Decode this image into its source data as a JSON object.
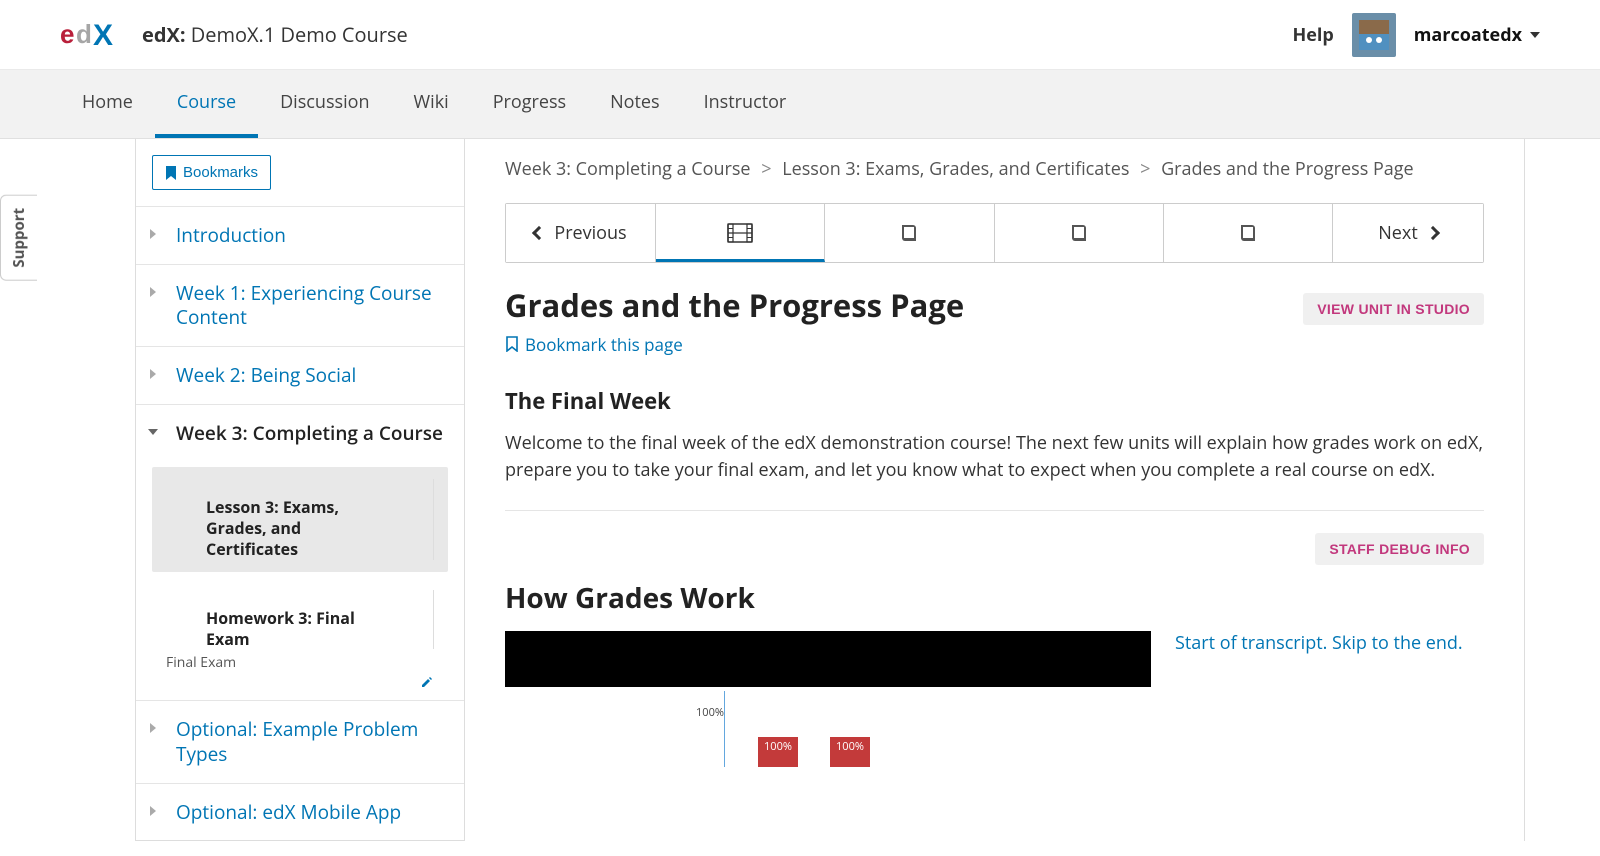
{
  "header": {
    "course_prefix": "edX:",
    "course_name": "DemoX.1 Demo Course",
    "help_label": "Help",
    "username": "marcoatedx"
  },
  "nav": {
    "items": [
      "Home",
      "Course",
      "Discussion",
      "Wiki",
      "Progress",
      "Notes",
      "Instructor"
    ],
    "active_index": 1
  },
  "support_tab": "Support",
  "sidebar": {
    "bookmarks_label": "Bookmarks",
    "sections": [
      {
        "label": "Introduction",
        "expanded": false
      },
      {
        "label": "Week 1: Experiencing Course Content",
        "expanded": false
      },
      {
        "label": "Week 2: Being Social",
        "expanded": false
      },
      {
        "label": "Week 3: Completing a Course",
        "expanded": true,
        "children": [
          {
            "main": "Lesson 3: Exams, Grades, and Certificates",
            "minor": "",
            "active": true
          },
          {
            "main": "Homework 3: Final Exam",
            "minor": "Final Exam",
            "editable": true
          }
        ]
      },
      {
        "label": "Optional: Example Problem Types",
        "expanded": false
      },
      {
        "label": "Optional: edX Mobile App",
        "expanded": false
      }
    ]
  },
  "breadcrumb": {
    "a": "Week 3: Completing a Course",
    "b": "Lesson 3: Exams, Grades, and Certificates",
    "c": "Grades and the Progress Page"
  },
  "seq": {
    "prev_label": "Previous",
    "next_label": "Next",
    "tabs": [
      {
        "icon": "video-icon",
        "active": true
      },
      {
        "icon": "book-icon",
        "active": false
      },
      {
        "icon": "book-icon",
        "active": false
      },
      {
        "icon": "book-icon",
        "active": false
      }
    ]
  },
  "page": {
    "title": "Grades and the Progress Page",
    "studio_btn": "VIEW UNIT IN STUDIO",
    "bookmark_link": "Bookmark this page",
    "section1_h": "The Final Week",
    "section1_body": "Welcome to the final week of the edX demonstration course! The next few units will explain how grades work on edX, prepare you to take your final exam, and let you know what to expect when you complete a real course on edX.",
    "debug_btn": "STAFF DEBUG INFO",
    "section2_h": "How Grades Work",
    "transcript_link": "Start of transcript. Skip to the end."
  },
  "chart_data": {
    "type": "bar",
    "y100_label": "100%",
    "bars": [
      "100%",
      "100%"
    ]
  }
}
